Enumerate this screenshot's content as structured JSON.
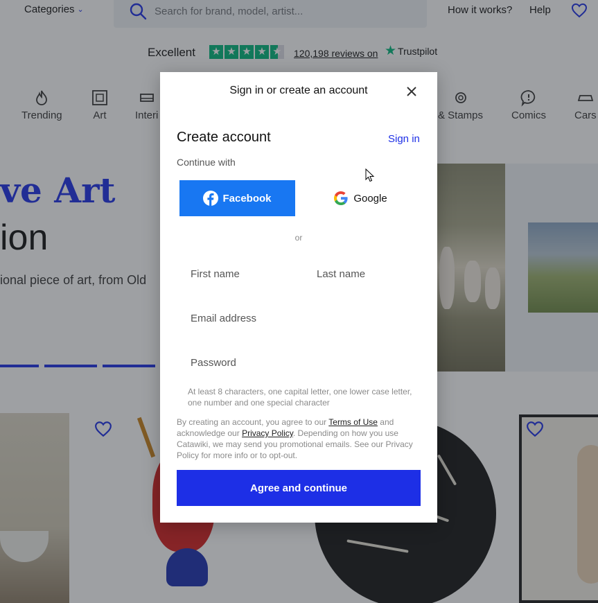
{
  "header": {
    "categories_label": "Categories",
    "search_placeholder": "Search for brand, model, artist...",
    "how_it_works": "How it works?",
    "help": "Help"
  },
  "trustbar": {
    "rating_label": "Excellent",
    "reviews_link": "120,198 reviews on",
    "brand": "Trustpilot",
    "stars": 4.5,
    "brand_color": "#00b67a"
  },
  "categories": [
    {
      "label": "Trending",
      "icon": "flame-icon"
    },
    {
      "label": "Art",
      "icon": "frame-icon"
    },
    {
      "label": "Interi",
      "icon": "sofa-icon"
    },
    {
      "label": "& Stamps",
      "icon": "coins-icon"
    },
    {
      "label": "Comics",
      "icon": "speech-bubble-icon"
    },
    {
      "label": "Cars",
      "icon": "car-icon"
    }
  ],
  "hero": {
    "title_line1": "ve Art",
    "title_line2": "ion",
    "subtitle": "ional piece of art, from Old"
  },
  "modal": {
    "title": "Sign in or create an account",
    "heading": "Create account",
    "sign_in_link": "Sign in",
    "continue_with": "Continue with",
    "facebook_label": "Facebook",
    "google_label": "Google",
    "or_label": "or",
    "first_name_placeholder": "First name",
    "last_name_placeholder": "Last name",
    "email_placeholder": "Email address",
    "password_placeholder": "Password",
    "password_hint": "At least 8 characters, one capital letter, one lower case letter, one number and one special character",
    "legal_part1": "By creating an account, you agree to our ",
    "terms_link": "Terms of Use",
    "legal_part2": " and acknowledge our ",
    "privacy_link": "Privacy Policy",
    "legal_part3": ". Depending on how you use Catawiki, we may send you promotional emails. See our Privacy Policy for more info or to opt-out.",
    "agree_button": "Agree and continue"
  },
  "colors": {
    "accent": "#1d2fe6",
    "facebook": "#1877f2"
  }
}
